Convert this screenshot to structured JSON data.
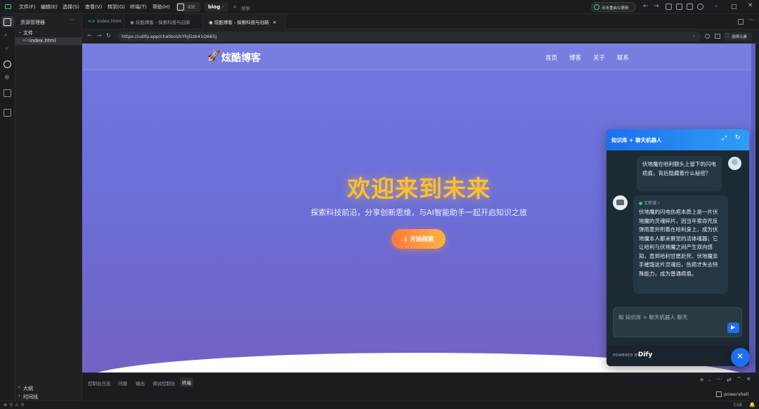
{
  "titlebar": {
    "menus": [
      "文件(F)",
      "编辑(E)",
      "选择(S)",
      "查看(V)",
      "转到(G)",
      "终端(T)",
      "帮助(H)"
    ],
    "ide_label": "IDE",
    "project": "blog",
    "search_placeholder": "搜索",
    "update_label": "点击重启以更新"
  },
  "sidebar": {
    "title": "资源管理器",
    "folder": "文件",
    "file": "index.html",
    "outline": "大纲",
    "timeline": "时间线"
  },
  "tabs": [
    {
      "label": "index.html",
      "icon": "code-icon"
    },
    {
      "label": "炫酷博客 - 探索科技与创新",
      "icon": "eye-icon"
    },
    {
      "label": "炫酷博客 - 探索科技与创新",
      "icon": "eye-icon"
    }
  ],
  "browser": {
    "url": "https://udify.app/chatbot/kYhjGzk41Q665j",
    "select_element": "选择元素"
  },
  "site": {
    "brand": "炫酷博客",
    "nav": [
      "首页",
      "博客",
      "关于",
      "联系"
    ],
    "hero_title": "欢迎来到未来",
    "hero_subtitle": "探索科技前沿，分享创新思维，与AI智能助手一起开启知识之旅",
    "hero_button": "↓ 开始探索"
  },
  "chat": {
    "title": "知识库 + 聊天机器人",
    "user_message": "伏地魔在哈利额头上留下的闪电疤痕，背后隐藏着什么秘密？",
    "workflow_label": "工作流",
    "bot_message": "伏地魔的闪电伤疤本质上是一片伏地魔的灵魂碎片，因当年索命咒反弹而意外附着在哈利身上，成为伏地魔本人都未察觉的活体魂器；它让哈利与伏地魔之间产生双向感知，直到哈利甘愿赴死、伏地魔亲手摧毁这片灵魂后，伤疤才失去特殊能力，成为普通疤痕。",
    "input_placeholder": "和 知识库 + 聊天机器人 聊天",
    "powered_by": "POWERED BY",
    "brand": "Dify"
  },
  "panel": {
    "tabs": [
      "控制台日志",
      "问题",
      "输出",
      "调试控制台",
      "终端"
    ],
    "active_tab": "终端",
    "terminal": "powershell"
  },
  "statusbar": {
    "errors": "0",
    "warnings": "0",
    "encoding": "CUE"
  },
  "colors": {
    "accent": "#1c6ff0",
    "hero_title": "#fbc02d",
    "button": "#ff8a3d"
  }
}
